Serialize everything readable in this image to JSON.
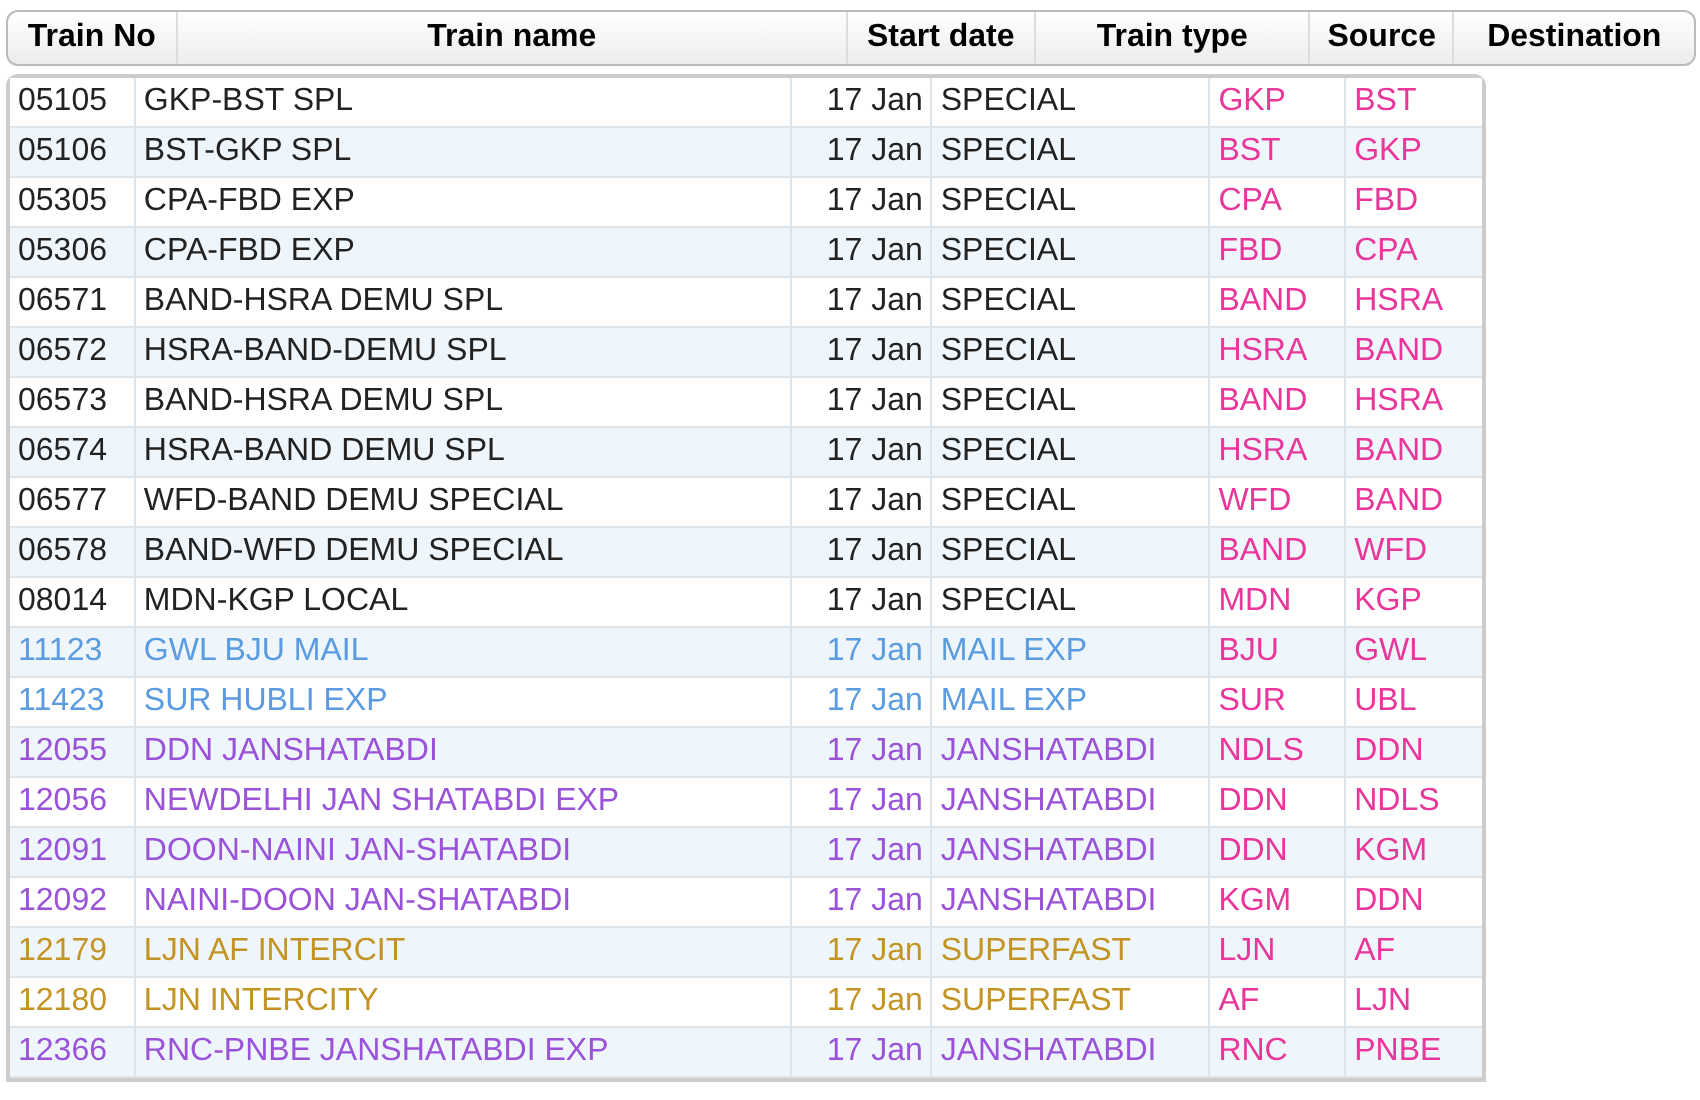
{
  "header": [
    "Train No",
    "Train name",
    "Start date",
    "Train type",
    "Source",
    "Destination"
  ],
  "rows": [
    {
      "no": "05105",
      "name": "GKP-BST SPL",
      "date": "17 Jan",
      "type": "SPECIAL",
      "kind": "special",
      "source": "GKP",
      "destination": "BST"
    },
    {
      "no": "05106",
      "name": "BST-GKP SPL",
      "date": "17 Jan",
      "type": "SPECIAL",
      "kind": "special",
      "source": "BST",
      "destination": "GKP"
    },
    {
      "no": "05305",
      "name": "CPA-FBD EXP",
      "date": "17 Jan",
      "type": "SPECIAL",
      "kind": "special",
      "source": "CPA",
      "destination": "FBD"
    },
    {
      "no": "05306",
      "name": "CPA-FBD EXP",
      "date": "17 Jan",
      "type": "SPECIAL",
      "kind": "special",
      "source": "FBD",
      "destination": "CPA"
    },
    {
      "no": "06571",
      "name": "BAND-HSRA DEMU SPL",
      "date": "17 Jan",
      "type": "SPECIAL",
      "kind": "special",
      "source": "BAND",
      "destination": "HSRA"
    },
    {
      "no": "06572",
      "name": "HSRA-BAND-DEMU SPL",
      "date": "17 Jan",
      "type": "SPECIAL",
      "kind": "special",
      "source": "HSRA",
      "destination": "BAND"
    },
    {
      "no": "06573",
      "name": "BAND-HSRA DEMU SPL",
      "date": "17 Jan",
      "type": "SPECIAL",
      "kind": "special",
      "source": "BAND",
      "destination": "HSRA"
    },
    {
      "no": "06574",
      "name": "HSRA-BAND DEMU SPL",
      "date": "17 Jan",
      "type": "SPECIAL",
      "kind": "special",
      "source": "HSRA",
      "destination": "BAND"
    },
    {
      "no": "06577",
      "name": "WFD-BAND DEMU SPECIAL",
      "date": "17 Jan",
      "type": "SPECIAL",
      "kind": "special",
      "source": "WFD",
      "destination": "BAND"
    },
    {
      "no": "06578",
      "name": "BAND-WFD DEMU SPECIAL",
      "date": "17 Jan",
      "type": "SPECIAL",
      "kind": "special",
      "source": "BAND",
      "destination": "WFD"
    },
    {
      "no": "08014",
      "name": "MDN-KGP LOCAL",
      "date": "17 Jan",
      "type": "SPECIAL",
      "kind": "special",
      "source": "MDN",
      "destination": "KGP"
    },
    {
      "no": "11123",
      "name": "GWL BJU MAIL",
      "date": "17 Jan",
      "type": "MAIL EXP",
      "kind": "mail",
      "source": "BJU",
      "destination": "GWL"
    },
    {
      "no": "11423",
      "name": "SUR HUBLI EXP",
      "date": "17 Jan",
      "type": "MAIL EXP",
      "kind": "mail",
      "source": "SUR",
      "destination": "UBL"
    },
    {
      "no": "12055",
      "name": "DDN JANSHATABDI",
      "date": "17 Jan",
      "type": "JANSHATABDI",
      "kind": "janshatabdi",
      "source": "NDLS",
      "destination": "DDN"
    },
    {
      "no": "12056",
      "name": "NEWDELHI JAN SHATABDI EXP",
      "date": "17 Jan",
      "type": "JANSHATABDI",
      "kind": "janshatabdi",
      "source": "DDN",
      "destination": "NDLS"
    },
    {
      "no": "12091",
      "name": "DOON-NAINI JAN-SHATABDI",
      "date": "17 Jan",
      "type": "JANSHATABDI",
      "kind": "janshatabdi",
      "source": "DDN",
      "destination": "KGM"
    },
    {
      "no": "12092",
      "name": "NAINI-DOON JAN-SHATABDI",
      "date": "17 Jan",
      "type": "JANSHATABDI",
      "kind": "janshatabdi",
      "source": "KGM",
      "destination": "DDN"
    },
    {
      "no": "12179",
      "name": "LJN AF INTERCIT",
      "date": "17 Jan",
      "type": "SUPERFAST",
      "kind": "superfast",
      "source": "LJN",
      "destination": "AF"
    },
    {
      "no": "12180",
      "name": "LJN INTERCITY",
      "date": "17 Jan",
      "type": "SUPERFAST",
      "kind": "superfast",
      "source": "AF",
      "destination": "LJN"
    },
    {
      "no": "12366",
      "name": "RNC-PNBE JANSHATABDI EXP",
      "date": "17 Jan",
      "type": "JANSHATABDI",
      "kind": "janshatabdi",
      "source": "RNC",
      "destination": "PNBE"
    }
  ]
}
